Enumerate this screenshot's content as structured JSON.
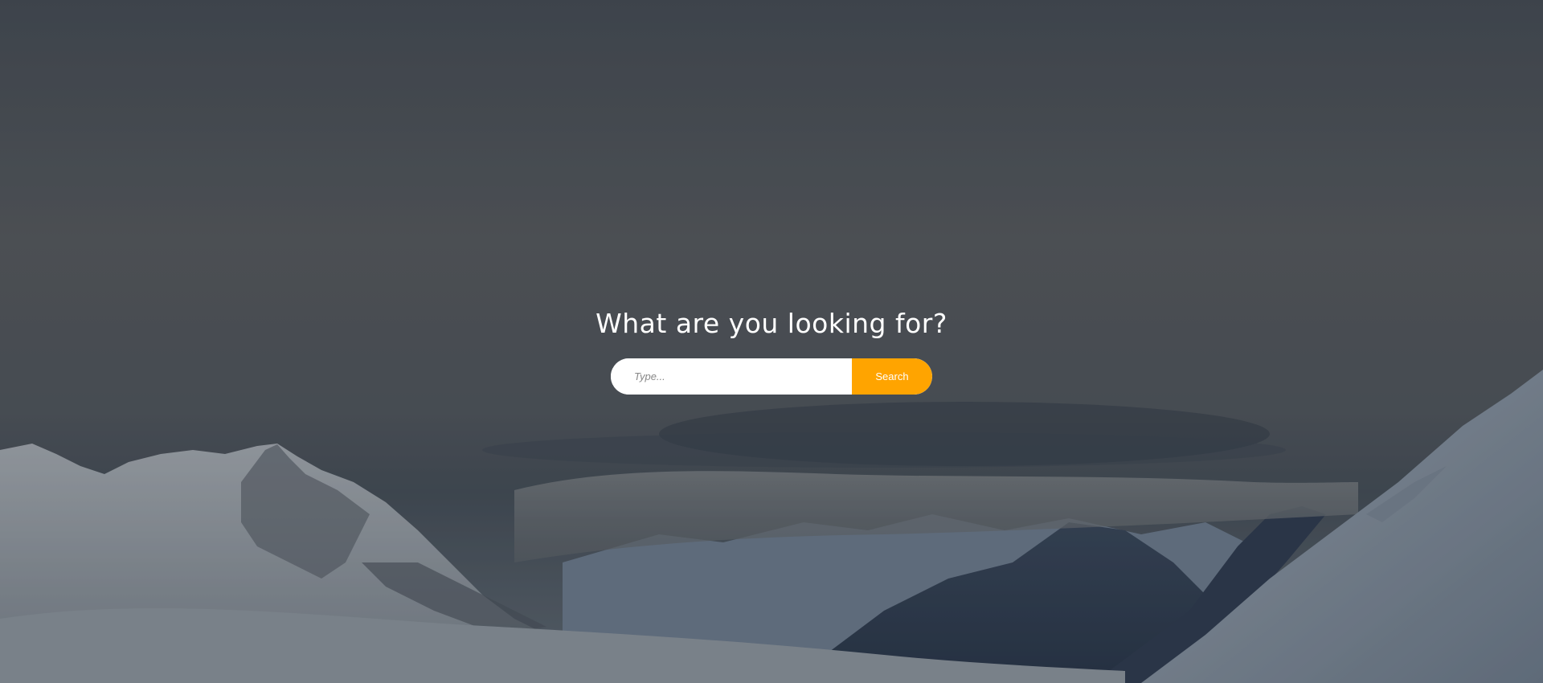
{
  "hero": {
    "heading": "What are you looking for?",
    "background": "snowy-mountains-landscape",
    "search": {
      "placeholder": "Type...",
      "button_label": "Search",
      "button_color": "#ffa400"
    }
  }
}
